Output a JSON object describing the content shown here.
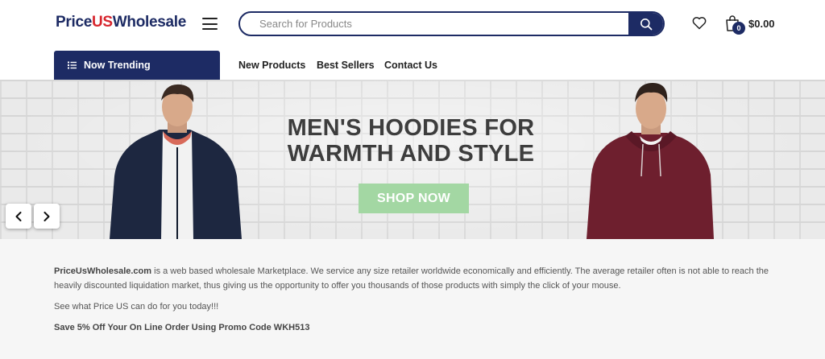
{
  "header": {
    "logo_part1": "Price",
    "logo_part2": "US",
    "logo_part3": "Wholesale",
    "search_placeholder": "Search for Products",
    "cart_count": "0",
    "cart_total": "$0.00"
  },
  "nav": {
    "trending_label": "Now Trending",
    "links": [
      "New Products",
      "Best Sellers",
      "Contact Us"
    ]
  },
  "hero": {
    "title_line1": "MEN'S HOODIES FOR",
    "title_line2": "WARMTH AND STYLE",
    "cta": "SHOP NOW"
  },
  "about": {
    "site_name": "PriceUsWholesale.com",
    "intro_rest": " is a web based wholesale Marketplace. We service any size retailer worldwide economically and efficiently. The average retailer often is not able to reach the heavily discounted liquidation market, thus giving us the opportunity to offer you thousands of those products with simply the click of your mouse.",
    "cta_line": "See what Price US can do for you today!!!",
    "promo": "Save 5% Off Your On Line Order Using Promo Code WKH513"
  },
  "colors": {
    "brand_navy": "#1d2b64",
    "brand_red": "#d7262e",
    "shop_now_green": "#a3d7a3"
  },
  "icons": [
    "menu-icon",
    "search-icon",
    "heart-icon",
    "shopping-bag-icon",
    "list-icon",
    "chevron-left-icon",
    "chevron-right-icon"
  ]
}
